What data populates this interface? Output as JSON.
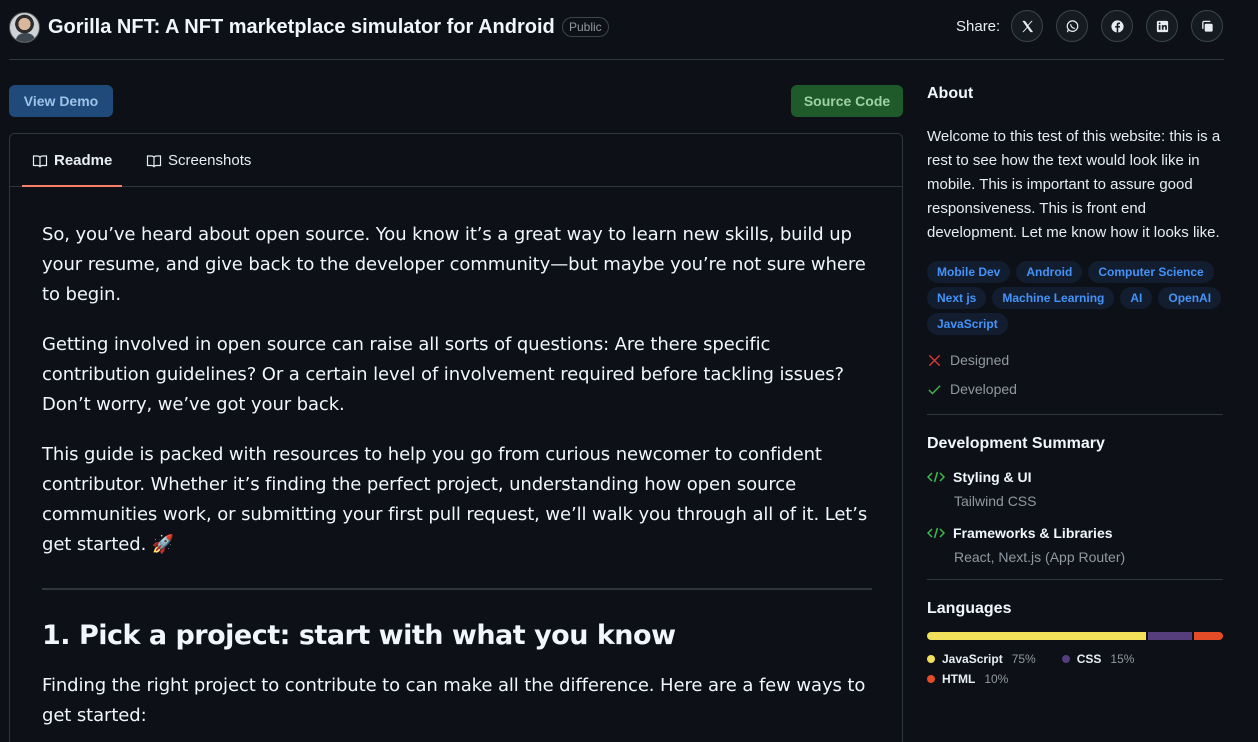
{
  "header": {
    "title": "Gorilla NFT: A NFT marketplace simulator for Android",
    "visibility": "Public",
    "share_label": "Share:",
    "share_buttons": [
      "x-icon",
      "whatsapp-icon",
      "facebook-icon",
      "linkedin-icon",
      "copy-icon"
    ]
  },
  "actions": {
    "demo_label": "View Demo",
    "source_label": "Source Code"
  },
  "tabs": [
    {
      "label": "Readme",
      "active": true
    },
    {
      "label": "Screenshots",
      "active": false
    }
  ],
  "readme": {
    "p1": "So, you’ve heard about open source. You know it’s a great way to learn new skills, build up your resume, and give back to the developer community—but maybe you’re not sure where to begin.",
    "p2": "Getting involved in open source can raise all sorts of questions: Are there specific contribution guidelines? Or a certain level of involvement required before tackling issues? Don’t worry, we’ve got your back.",
    "p3": "This guide is packed with resources to help you go from curious newcomer to confident contributor. Whether it’s finding the perfect project, understanding how open source communities work, or submitting your first pull request, we’ll walk you through all of it. Let’s get started. 🚀",
    "h2": "1. Pick a project: start with what you know",
    "p4": "Finding the right project to contribute to can make all the difference. Here are a few ways to get started:"
  },
  "about": {
    "heading": "About",
    "text": "Welcome to this test of this website: this is a rest to see how the text would look like in mobile. This is important to assure good responsiveness. This is front end development. Let me know how it looks like.",
    "tags": [
      "Mobile Dev",
      "Android",
      "Computer Science",
      "Next js",
      "Machine Learning",
      "AI",
      "OpenAI",
      "JavaScript"
    ],
    "designed_label": "Designed",
    "developed_label": "Developed"
  },
  "dev_summary": {
    "heading": "Development Summary",
    "items": [
      {
        "title": "Styling & UI",
        "detail": "Tailwind CSS"
      },
      {
        "title": "Frameworks & Libraries",
        "detail": "React, Next.js (App Router)"
      }
    ]
  },
  "languages": {
    "heading": "Languages",
    "items": [
      {
        "name": "JavaScript",
        "percent": "75%",
        "value": 75,
        "color": "#f1e05a"
      },
      {
        "name": "CSS",
        "percent": "15%",
        "value": 15,
        "color": "#563d7c"
      },
      {
        "name": "HTML",
        "percent": "10%",
        "value": 10,
        "color": "#e34c26"
      }
    ]
  },
  "colors": {
    "tab_active_underline": "#f78166",
    "tag_text": "#4493f8",
    "designed_icon": "#da3633",
    "developed_icon": "#3fb950",
    "code_icon": "#3fb950"
  }
}
